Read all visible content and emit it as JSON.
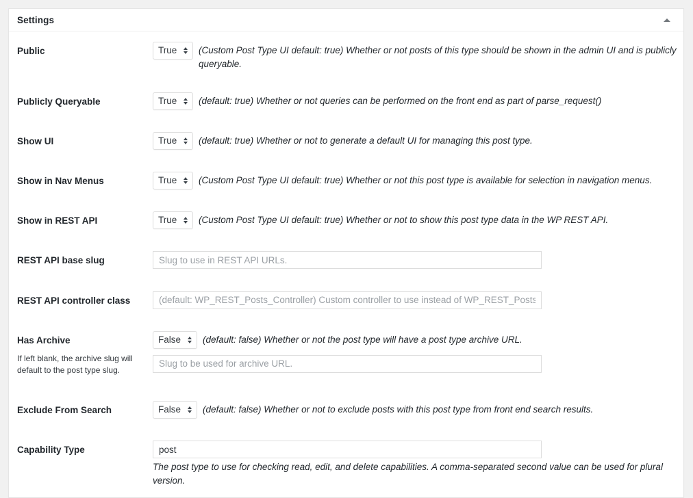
{
  "panel": {
    "title": "Settings",
    "toggle_icon": "caret-up-icon"
  },
  "select_options": [
    "True",
    "False"
  ],
  "rows": [
    {
      "label": "Public",
      "control": "select",
      "value": "True",
      "description": "(Custom Post Type UI default: true) Whether or not posts of this type should be shown in the admin UI and is publicly queryable."
    },
    {
      "label": "Publicly Queryable",
      "control": "select",
      "value": "True",
      "description": "(default: true) Whether or not queries can be performed on the front end as part of parse_request()"
    },
    {
      "label": "Show UI",
      "control": "select",
      "value": "True",
      "description": "(default: true) Whether or not to generate a default UI for managing this post type."
    },
    {
      "label": "Show in Nav Menus",
      "control": "select",
      "value": "True",
      "description": "(Custom Post Type UI default: true) Whether or not this post type is available for selection in navigation menus."
    },
    {
      "label": "Show in REST API",
      "control": "select",
      "value": "True",
      "description": "(Custom Post Type UI default: true) Whether or not to show this post type data in the WP REST API."
    },
    {
      "label": "REST API base slug",
      "control": "text",
      "value": "",
      "placeholder": "Slug to use in REST API URLs."
    },
    {
      "label": "REST API controller class",
      "control": "text",
      "value": "",
      "placeholder": "(default: WP_REST_Posts_Controller) Custom controller to use instead of WP_REST_Posts_Controller."
    },
    {
      "label": "Has Archive",
      "label_sub": "If left blank, the archive slug will default to the post type slug.",
      "control": "select-plus-text",
      "value": "False",
      "description": "(default: false) Whether or not the post type will have a post type archive URL.",
      "placeholder": "Slug to be used for archive URL."
    },
    {
      "label": "Exclude From Search",
      "control": "select",
      "value": "False",
      "description": "(default: false) Whether or not to exclude posts with this post type from front end search results."
    },
    {
      "label": "Capability Type",
      "control": "text-with-desc",
      "value": "post",
      "description": "The post type to use for checking read, edit, and delete capabilities. A comma-separated second value can be used for plural version."
    }
  ]
}
